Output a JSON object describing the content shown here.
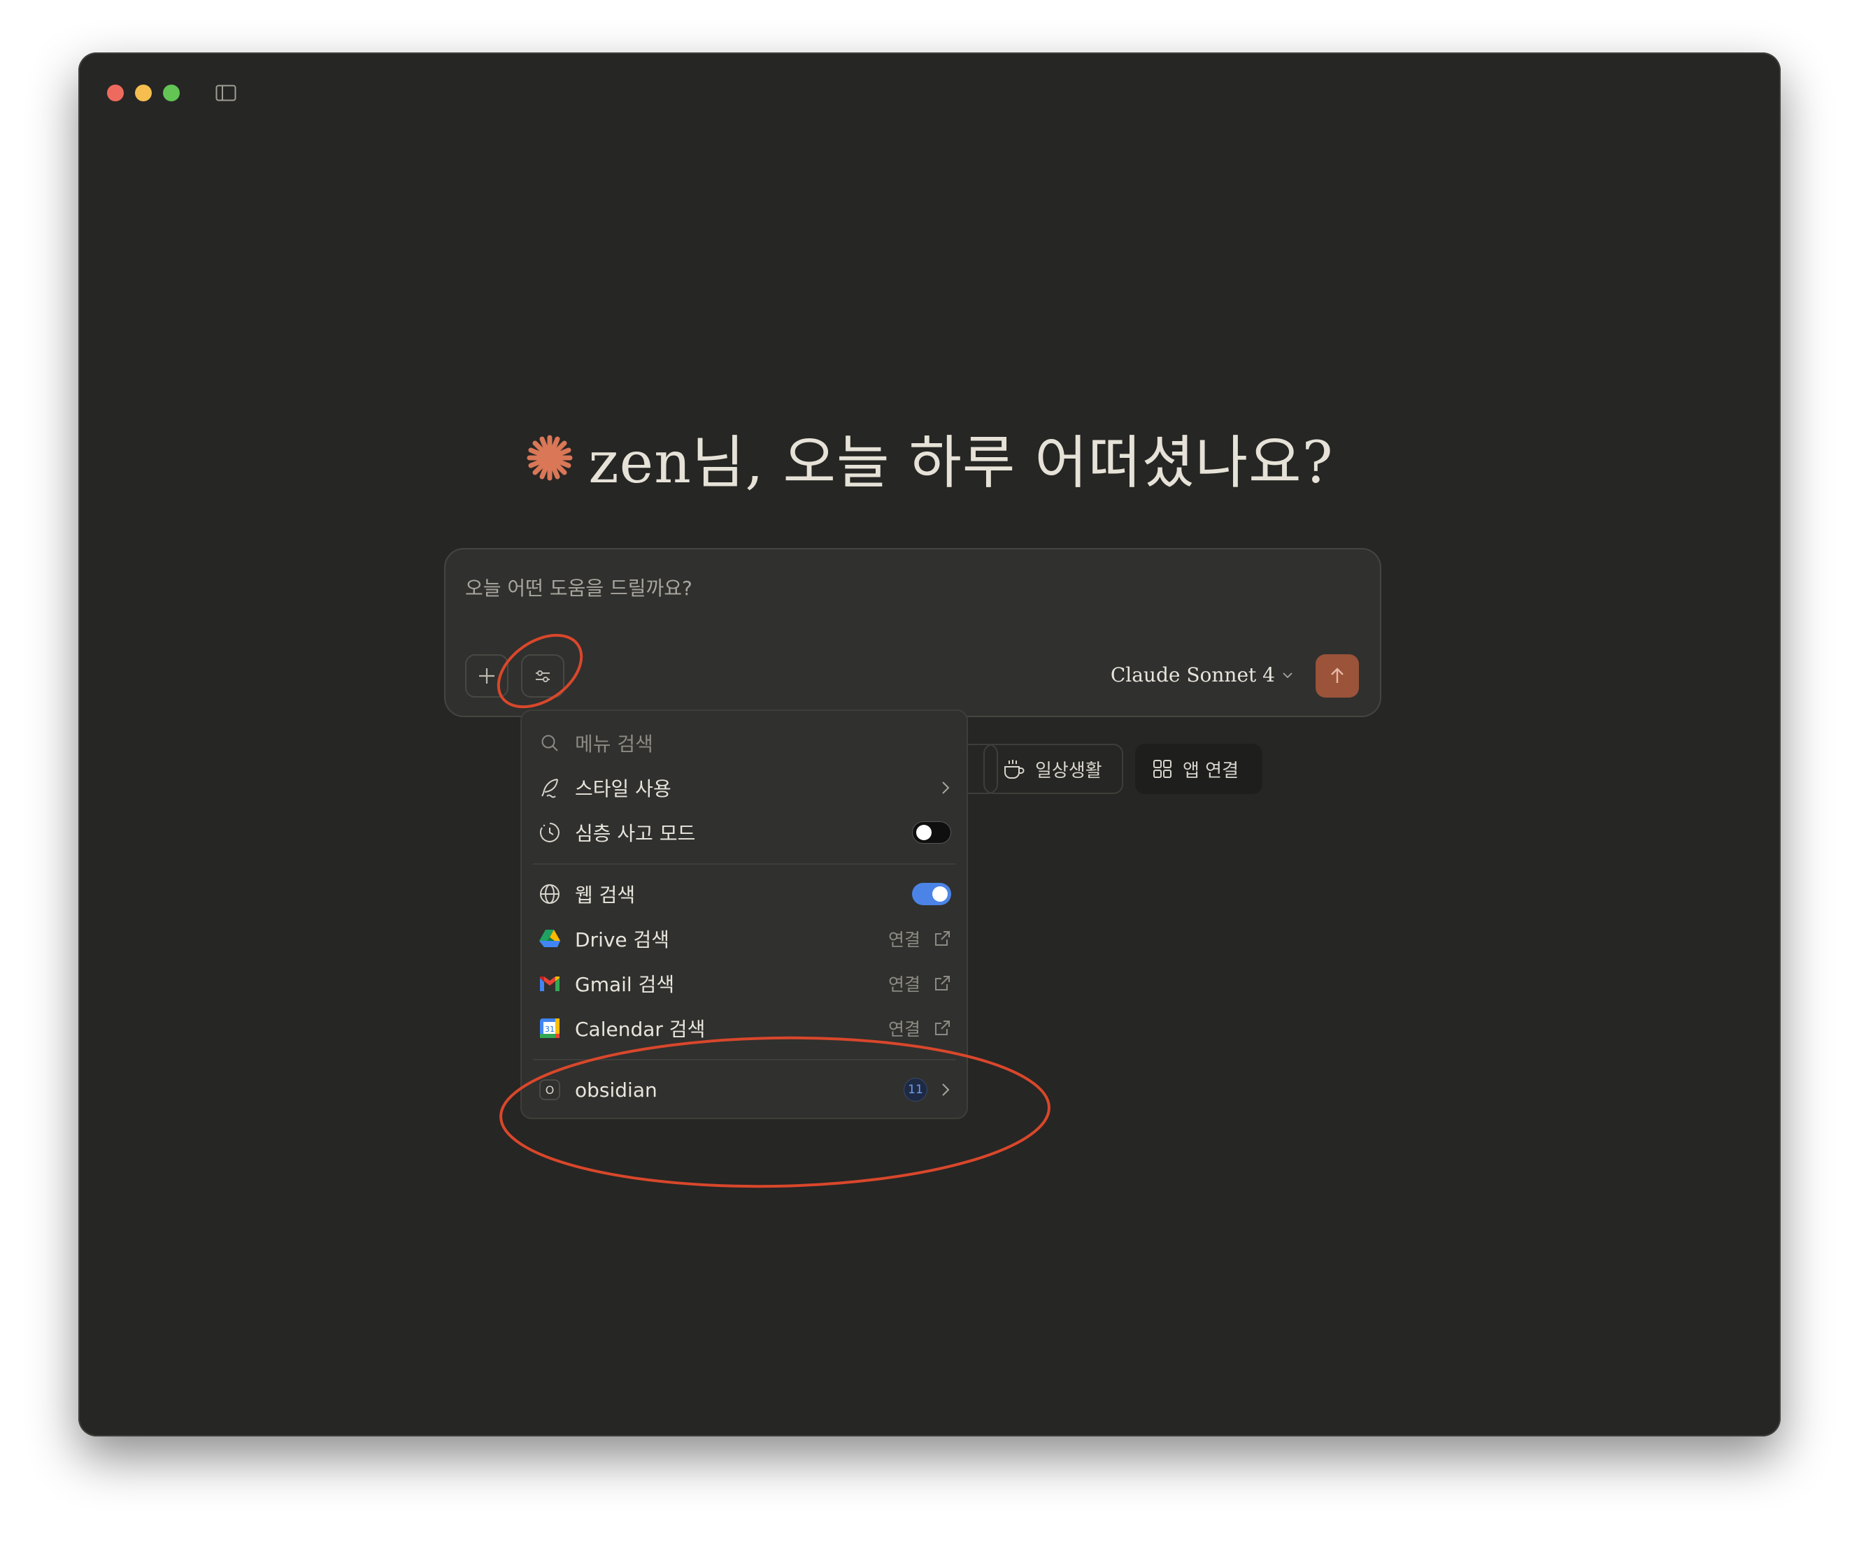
{
  "window": {
    "traffic_lights": [
      "close",
      "minimize",
      "zoom"
    ],
    "sidebar_toggle_icon": "sidebar-icon"
  },
  "greeting": {
    "icon": "claude-spark-icon",
    "icon_color": "#d97757",
    "text": "zen님, 오늘 하루 어떠셨나요?"
  },
  "composer": {
    "placeholder": "오늘 어떤 도움을 드릴까요?",
    "model": "Claude Sonnet 4",
    "send_color": "#9b5339"
  },
  "chips": {
    "life_label": "일상생활",
    "apps_label": "앱 연결"
  },
  "menu": {
    "search_placeholder": "메뉴 검색",
    "style_label": "스타일 사용",
    "deep_thinking_label": "심층 사고 모드",
    "deep_thinking_on": false,
    "web_search_label": "웹 검색",
    "web_search_on": true,
    "drive_label": "Drive 검색",
    "gmail_label": "Gmail 검색",
    "calendar_label": "Calendar 검색",
    "calendar_icon_text": "31",
    "connect_label": "연결",
    "obsidian_label": "obsidian",
    "obsidian_icon_text": "O",
    "obsidian_count": "11"
  }
}
